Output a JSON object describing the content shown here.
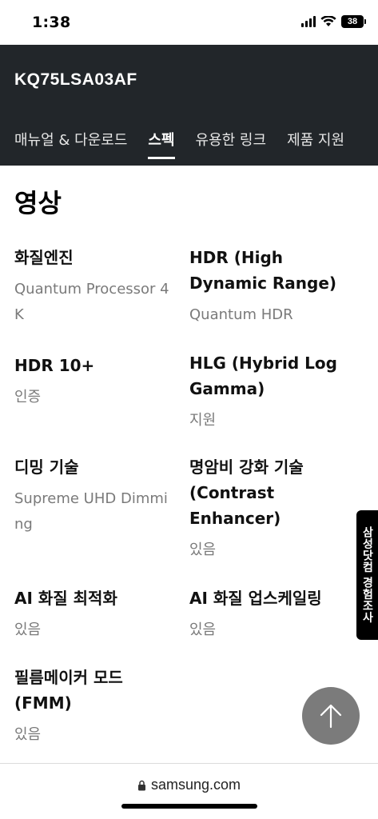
{
  "status_bar": {
    "time": "1:38",
    "battery": "38"
  },
  "header": {
    "model": "KQ75LSA03AF",
    "tabs": [
      {
        "label": "매뉴얼 & 다운로드",
        "active": false
      },
      {
        "label": "스펙",
        "active": true
      },
      {
        "label": "유용한 링크",
        "active": false
      },
      {
        "label": "제품 지원",
        "active": false
      }
    ]
  },
  "section": {
    "title": "영상",
    "specs": [
      {
        "label": "화질엔진",
        "value": "Quantum Processor 4K"
      },
      {
        "label": "HDR (High Dynamic Range)",
        "value": "Quantum HDR"
      },
      {
        "label": "HDR 10+",
        "value": "인증"
      },
      {
        "label": "HLG (Hybrid Log Gamma)",
        "value": "지원"
      },
      {
        "label": "디밍 기술",
        "value": "Supreme UHD Dimming"
      },
      {
        "label": "명암비 강화 기술 (Contrast Enhancer)",
        "value": "있음"
      },
      {
        "label": "AI 화질 최적화",
        "value": "있음"
      },
      {
        "label": "AI 화질 업스케일링",
        "value": "있음"
      },
      {
        "label": "필름메이커 모드 (FMM)",
        "value": "있음"
      }
    ]
  },
  "survey_tab": {
    "label": "삼성닷컴 경험조사"
  },
  "bottom_bar": {
    "url": "samsung.com"
  },
  "icons": {
    "signal": "cellular-signal-icon",
    "wifi": "wifi-icon",
    "battery": "battery-icon",
    "lock": "lock-icon",
    "arrow_up": "arrow-up-icon"
  },
  "colors": {
    "header_bg": "#22262a",
    "top_button": "#7b7b7b",
    "value_text": "#7a7a7a"
  }
}
